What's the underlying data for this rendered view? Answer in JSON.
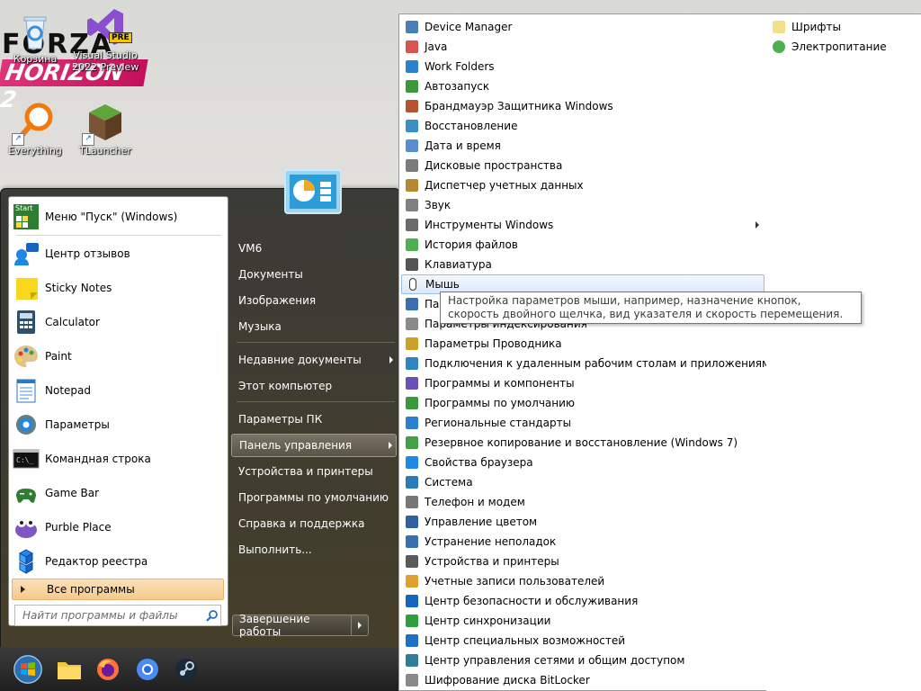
{
  "desktop": {
    "icons": [
      {
        "label": "Корзина",
        "icon": "recycle-bin-icon"
      },
      {
        "label": "Visual Studio\n2022 Preview",
        "icon": "visual-studio-icon",
        "badge": "PRE"
      },
      {
        "label": "Everything",
        "icon": "everything-search-icon"
      },
      {
        "label": "TLauncher",
        "icon": "tlauncher-icon"
      }
    ],
    "wallpaper_logo": {
      "line1": "FORZA",
      "line2": "HORIZON 2"
    }
  },
  "start_menu": {
    "pinned": [
      {
        "label": "Меню \"Пуск\" (Windows)",
        "icon": "start-menu-icon",
        "icon_text": "Start"
      }
    ],
    "recent": [
      {
        "label": "Центр отзывов",
        "icon": "feedback-hub-icon"
      },
      {
        "label": "Sticky Notes",
        "icon": "sticky-notes-icon"
      },
      {
        "label": "Calculator",
        "icon": "calculator-icon"
      },
      {
        "label": "Paint",
        "icon": "paint-icon"
      },
      {
        "label": "Notepad",
        "icon": "notepad-icon"
      },
      {
        "label": "Параметры",
        "icon": "settings-gear-icon"
      },
      {
        "label": "Командная строка",
        "icon": "command-prompt-icon"
      },
      {
        "label": "Game Bar",
        "icon": "game-bar-icon"
      },
      {
        "label": "Purble Place",
        "icon": "purble-place-icon"
      },
      {
        "label": "Редактор реестра",
        "icon": "registry-editor-icon"
      }
    ],
    "all_programs": "Все программы",
    "search_placeholder": "Найти программы и файлы",
    "right_items": [
      {
        "label": "VM6"
      },
      {
        "label": "Документы"
      },
      {
        "label": "Изображения"
      },
      {
        "label": "Музыка"
      },
      {
        "label": "Недавние документы",
        "submenu": true
      },
      {
        "label": "Этот компьютер"
      },
      {
        "label": "Параметры ПК"
      },
      {
        "label": "Панель управления",
        "submenu": true,
        "active": true
      },
      {
        "label": "Устройства и принтеры"
      },
      {
        "label": "Программы по умолчанию"
      },
      {
        "label": "Справка и поддержка"
      },
      {
        "label": "Выполнить..."
      }
    ],
    "shutdown": "Завершение работы"
  },
  "taskbar": {
    "items": [
      "start-orb-icon",
      "file-explorer-icon",
      "firefox-icon",
      "chromium-icon",
      "steam-icon"
    ]
  },
  "control_panel_menu": {
    "column1": [
      {
        "label": "Device Manager",
        "icon": "device-manager-icon"
      },
      {
        "label": "Java",
        "icon": "java-icon"
      },
      {
        "label": "Work Folders",
        "icon": "work-folders-icon"
      },
      {
        "label": "Автозапуск",
        "icon": "autoplay-icon"
      },
      {
        "label": "Брандмауэр Защитника Windows",
        "icon": "firewall-icon"
      },
      {
        "label": "Восстановление",
        "icon": "recovery-icon"
      },
      {
        "label": "Дата и время",
        "icon": "date-time-icon"
      },
      {
        "label": "Дисковые пространства",
        "icon": "storage-spaces-icon"
      },
      {
        "label": "Диспетчер учетных данных",
        "icon": "credential-manager-icon"
      },
      {
        "label": "Звук",
        "icon": "sound-icon"
      },
      {
        "label": "Инструменты Windows",
        "icon": "windows-tools-icon",
        "submenu": true
      },
      {
        "label": "История файлов",
        "icon": "file-history-icon"
      },
      {
        "label": "Клавиатура",
        "icon": "keyboard-icon"
      },
      {
        "label": "Мышь",
        "icon": "mouse-icon",
        "highlighted": true
      },
      {
        "label": "Панель задач и навигация",
        "icon": "taskbar-settings-icon"
      },
      {
        "label": "Параметры индексирования",
        "icon": "indexing-options-icon"
      },
      {
        "label": "Параметры Проводника",
        "icon": "explorer-options-icon"
      },
      {
        "label": "Подключения к удаленным рабочим столам и приложениям R...",
        "icon": "remote-desktop-icon"
      },
      {
        "label": "Программы и компоненты",
        "icon": "programs-features-icon"
      },
      {
        "label": "Программы по умолчанию",
        "icon": "default-programs-icon"
      },
      {
        "label": "Региональные стандарты",
        "icon": "region-icon"
      },
      {
        "label": "Резервное копирование и восстановление (Windows 7)",
        "icon": "backup-restore-icon"
      },
      {
        "label": "Свойства браузера",
        "icon": "internet-options-icon"
      },
      {
        "label": "Система",
        "icon": "system-icon"
      },
      {
        "label": "Телефон и модем",
        "icon": "phone-modem-icon"
      },
      {
        "label": "Управление цветом",
        "icon": "color-management-icon"
      },
      {
        "label": "Устранение неполадок",
        "icon": "troubleshooting-icon"
      },
      {
        "label": "Устройства и принтеры",
        "icon": "devices-printers-icon"
      },
      {
        "label": "Учетные записи пользователей",
        "icon": "user-accounts-icon"
      },
      {
        "label": "Центр безопасности и обслуживания",
        "icon": "security-maintenance-icon"
      },
      {
        "label": "Центр синхронизации",
        "icon": "sync-center-icon"
      },
      {
        "label": "Центр специальных возможностей",
        "icon": "ease-of-access-icon"
      },
      {
        "label": "Центр управления сетями и общим доступом",
        "icon": "network-sharing-icon"
      },
      {
        "label": "Шифрование диска BitLocker",
        "icon": "bitlocker-icon"
      }
    ],
    "column2": [
      {
        "label": "Шрифты",
        "icon": "fonts-icon"
      },
      {
        "label": "Электропитание",
        "icon": "power-options-icon"
      }
    ],
    "tooltip": "Настройка параметров мыши, например, назначение кнопок, скорость двойного щелчка, вид указателя и скорость перемещения."
  }
}
